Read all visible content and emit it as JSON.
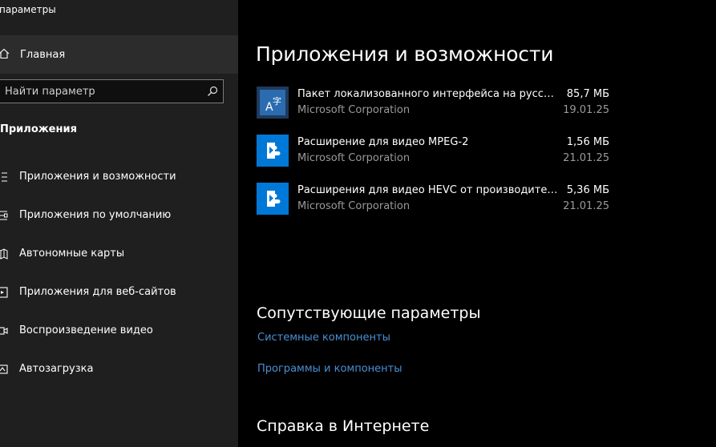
{
  "window": {
    "title": "Параметры"
  },
  "sidebar": {
    "home_label": "Главная",
    "search_placeholder": "Найти параметр",
    "section_title": "Приложения",
    "items": [
      {
        "label": "Приложения и возможности",
        "icon": "apps-list-icon"
      },
      {
        "label": "Приложения по умолчанию",
        "icon": "default-apps-icon"
      },
      {
        "label": "Автономные карты",
        "icon": "offline-maps-icon"
      },
      {
        "label": "Приложения для веб-сайтов",
        "icon": "websites-icon"
      },
      {
        "label": "Воспроизведение видео",
        "icon": "video-playback-icon"
      },
      {
        "label": "Автозагрузка",
        "icon": "startup-icon"
      }
    ]
  },
  "main": {
    "page_title": "Приложения и возможности",
    "apps": [
      {
        "name": "Пакет локализованного интерфейса на русском",
        "publisher": "Microsoft Corporation",
        "size": "85,7 МБ",
        "date": "19.01.25",
        "icon": "language-pack-icon"
      },
      {
        "name": "Расширение для видео MPEG-2",
        "publisher": "Microsoft Corporation",
        "size": "1,56 МБ",
        "date": "21.01.25",
        "icon": "video-extension-icon"
      },
      {
        "name": "Расширения для видео HEVC от производителя устройства",
        "publisher": "Microsoft Corporation",
        "size": "5,36 МБ",
        "date": "21.01.25",
        "icon": "video-extension-icon"
      }
    ],
    "related_title": "Сопутствующие параметры",
    "related_links": [
      "Системные компоненты",
      "Программы и компоненты"
    ],
    "help_title": "Справка в Интернете"
  },
  "colors": {
    "accent": "#0078d7",
    "link": "#4a8fd4",
    "sidebar_bg": "#1f1f1f",
    "main_bg": "#000000"
  }
}
